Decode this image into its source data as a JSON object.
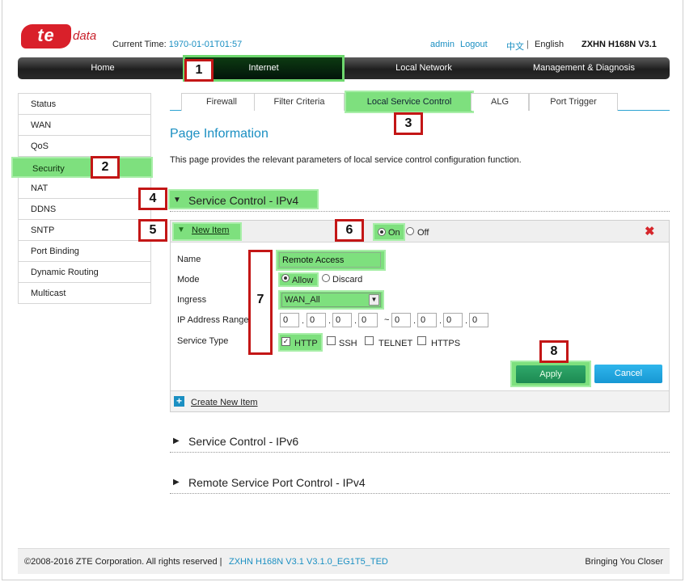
{
  "header": {
    "logo_text": "te",
    "logo_suffix": "data",
    "time_label": "Current Time:",
    "time_value": "1970-01-01T01:57",
    "user": "admin",
    "logout": "Logout",
    "lang_cn": "中文",
    "lang_sep": "|",
    "lang_en": "English",
    "model": "ZXHN H168N V3.1"
  },
  "nav": {
    "home": "Home",
    "internet": "Internet",
    "local_network": "Local Network",
    "management": "Management & Diagnosis"
  },
  "sidebar": {
    "items": [
      "Status",
      "WAN",
      "QoS",
      "Security",
      "NAT",
      "DDNS",
      "SNTP",
      "Port Binding",
      "Dynamic Routing",
      "Multicast"
    ],
    "active": "Security"
  },
  "tabs": [
    "Firewall",
    "Filter Criteria",
    "Local Service Control",
    "ALG",
    "Port Trigger"
  ],
  "page": {
    "title": "Page Information",
    "description": "This page provides the relevant parameters of local service control configuration function."
  },
  "section_ipv4": "Service Control - IPv4",
  "item": {
    "title": "New Item",
    "on_label": "On",
    "off_label": "Off",
    "state": "On",
    "name_label": "Name",
    "name_value": "Remote Access",
    "mode_label": "Mode",
    "mode_allow": "Allow",
    "mode_discard": "Discard",
    "mode_value": "Allow",
    "ingress_label": "Ingress",
    "ingress_value": "WAN_All",
    "ip_label": "IP Address Range",
    "ip_start": [
      "0",
      "0",
      "0",
      "0"
    ],
    "ip_end": [
      "0",
      "0",
      "0",
      "0"
    ],
    "service_label": "Service Type",
    "services": [
      "HTTP",
      "SSH",
      "TELNET",
      "HTTPS"
    ],
    "services_checked": [
      "HTTP"
    ],
    "apply": "Apply",
    "cancel": "Cancel",
    "create_new": "Create New Item"
  },
  "section_ipv6": "Service Control - IPv6",
  "section_remote": "Remote Service Port Control - IPv4",
  "callouts": [
    "1",
    "2",
    "3",
    "4",
    "5",
    "6",
    "7",
    "8"
  ],
  "footer": {
    "copyright": "©2008-2016 ZTE Corporation. All rights reserved  |",
    "version": "ZXHN H168N V3.1 V3.1.0_EG1T5_TED",
    "slogan": "Bringing You Closer"
  },
  "colors": {
    "accent": "#1a8fc2",
    "highlight": "#7ee07e",
    "callout_border": "#c31616",
    "brand_red": "#d9202a"
  }
}
